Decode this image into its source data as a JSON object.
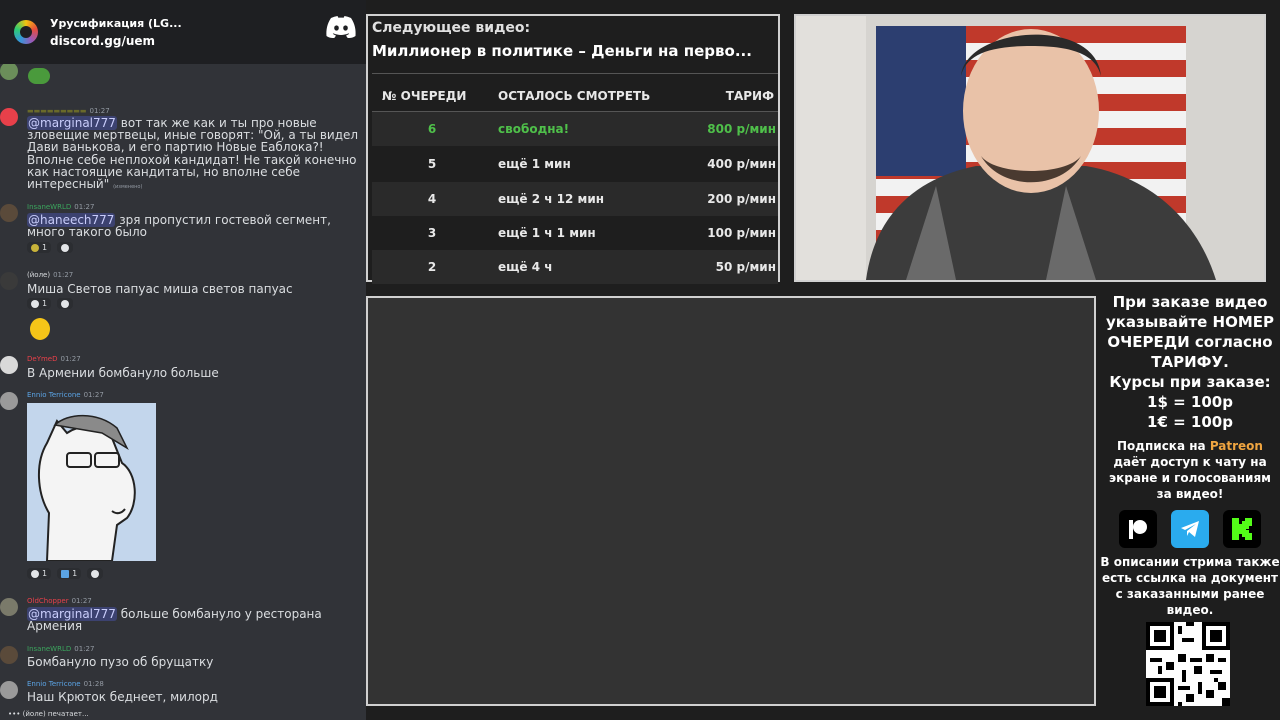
{
  "discord": {
    "server_name": "Урусификация (LG...",
    "invite": "discord.gg/uem",
    "messages": [
      {
        "author": "",
        "time": "01:27",
        "text": "вот так же как и ты про новые зловещие мертвецы, иные говорят: \"Ой, а ты видел Дави ванькова, и его партию Новые Еаблока?! Вполне себе неплохой кандидат! Не такой конечно как настоящие кандитаты, но вполне себе интересный\"",
        "mention": "@marginal777",
        "edited": "(изменено)"
      },
      {
        "author": "InsaneWRLD",
        "time": "01:27",
        "mention": "@haneech777",
        "text": "зря пропустил гостевой  сегмент, много такого было",
        "reaction": "1"
      },
      {
        "author": "(йоле)",
        "time": "01:27",
        "text": "Миша Светов папуас миша светов папуас",
        "reaction": "1"
      },
      {
        "author": "DeYmeD",
        "time": "01:27",
        "text": "В Армении бомбануло больше"
      },
      {
        "author": "Ennio Terricone",
        "time": "01:27",
        "reactions": [
          "1",
          "1"
        ]
      },
      {
        "author": "OldChopper",
        "time": "01:27",
        "mention": "@marginal777",
        "text": "больше бомбануло у ресторана Армения"
      },
      {
        "author": "InsaneWRLD",
        "time": "01:27",
        "text": "Бомбануло пузо об брущатку"
      },
      {
        "author": "Ennio Terricone",
        "time": "01:28",
        "text": "Наш Крюток беднеет, милорд"
      }
    ],
    "typing": "(йоле) печатает..."
  },
  "queue": {
    "next_label": "Следующее видео:",
    "next_title": "Миллионер в политике – Деньги на перво...",
    "headers": {
      "num": "№ ОЧЕРЕДИ",
      "left": "ОСТАЛОСЬ СМОТРЕТЬ",
      "rate": "ТАРИФ"
    },
    "rows": [
      {
        "num": "6",
        "left": "свободна!",
        "rate": "800 р/мин"
      },
      {
        "num": "5",
        "left": "ещё 1 мин",
        "rate": "400 р/мин"
      },
      {
        "num": "4",
        "left": "ещё 2 ч 12 мин",
        "rate": "200 р/мин"
      },
      {
        "num": "3",
        "left": "ещё 1 ч 1 мин",
        "rate": "100 р/мин"
      },
      {
        "num": "2",
        "left": "ещё 4 ч",
        "rate": "50 р/мин"
      }
    ]
  },
  "info": {
    "order_text": "При заказе видео указывайте НОМЕР ОЧЕРЕДИ согласно ТАРИФУ.",
    "rates_title": "Курсы при заказе:",
    "usd": "1$ = 100р",
    "eur": "1€ = 100р",
    "patreon_pre": "Подписка на",
    "patreon_word": "Patreon",
    "patreon_post": "даёт доступ к чату на экране и голосованиям за видео!",
    "description_note": "В описании стрима также есть ссылка на документ с заказанными ранее видео."
  },
  "colors": {
    "free": "#4fc04a",
    "patreon": "#f0a540",
    "kick": "#53fc18",
    "telegram": "#2aabee"
  }
}
